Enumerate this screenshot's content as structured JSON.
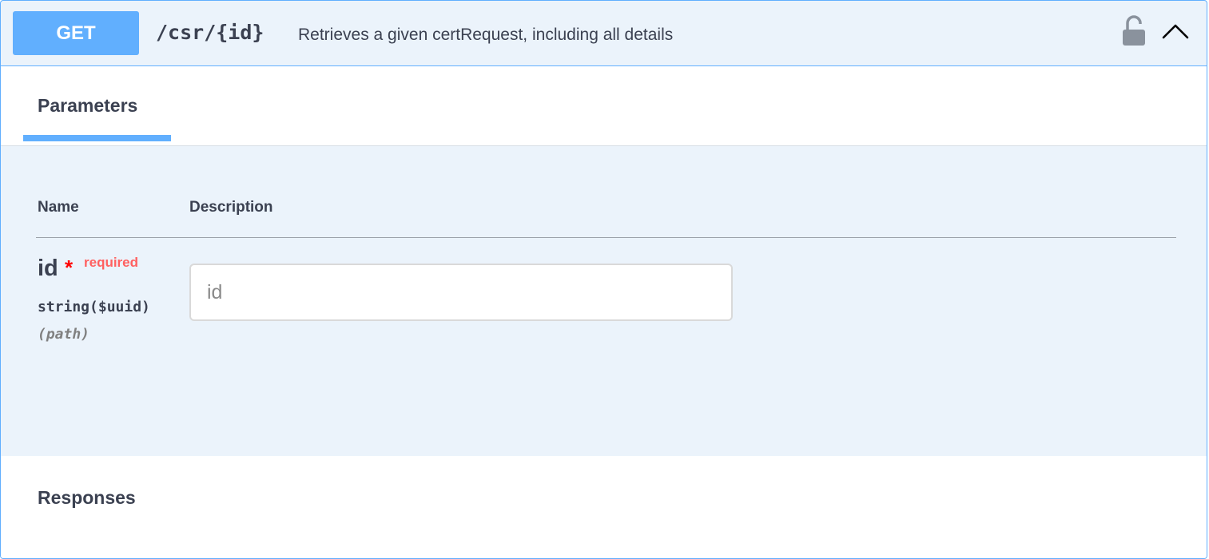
{
  "operation": {
    "method": "GET",
    "path": "/csr/{id}",
    "summary": "Retrieves a given certRequest, including all details",
    "accent_color": "#61affe"
  },
  "icons": {
    "lock": "unlocked-padlock-icon",
    "collapse": "chevron-up-icon"
  },
  "parameters_section": {
    "title": "Parameters",
    "columns": {
      "name": "Name",
      "description": "Description"
    },
    "items": [
      {
        "name": "id",
        "required_marker": "*",
        "required_label": "required",
        "type": "string($uuid)",
        "location": "(path)",
        "input_value": "",
        "input_placeholder": "id"
      }
    ]
  },
  "responses_section": {
    "title": "Responses"
  }
}
